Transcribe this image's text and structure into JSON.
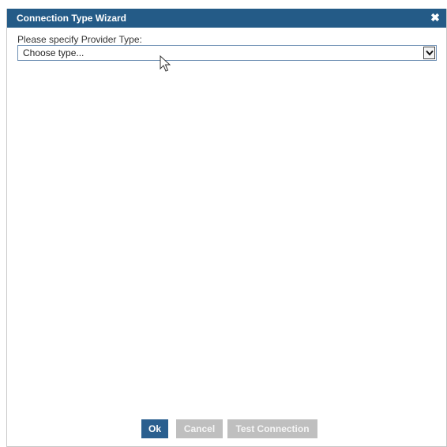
{
  "dialog": {
    "title": "Connection Type Wizard",
    "close_icon": "close-icon"
  },
  "form": {
    "provider_label": "Please specify Provider Type:",
    "provider_select": {
      "selected": "Choose type..."
    }
  },
  "buttons": {
    "ok": "Ok",
    "cancel": "Cancel",
    "test_connection": "Test Connection"
  },
  "colors": {
    "titlebar": "#245b87",
    "primary_button": "#2a5f8f",
    "disabled_button": "#bfbfbf"
  }
}
